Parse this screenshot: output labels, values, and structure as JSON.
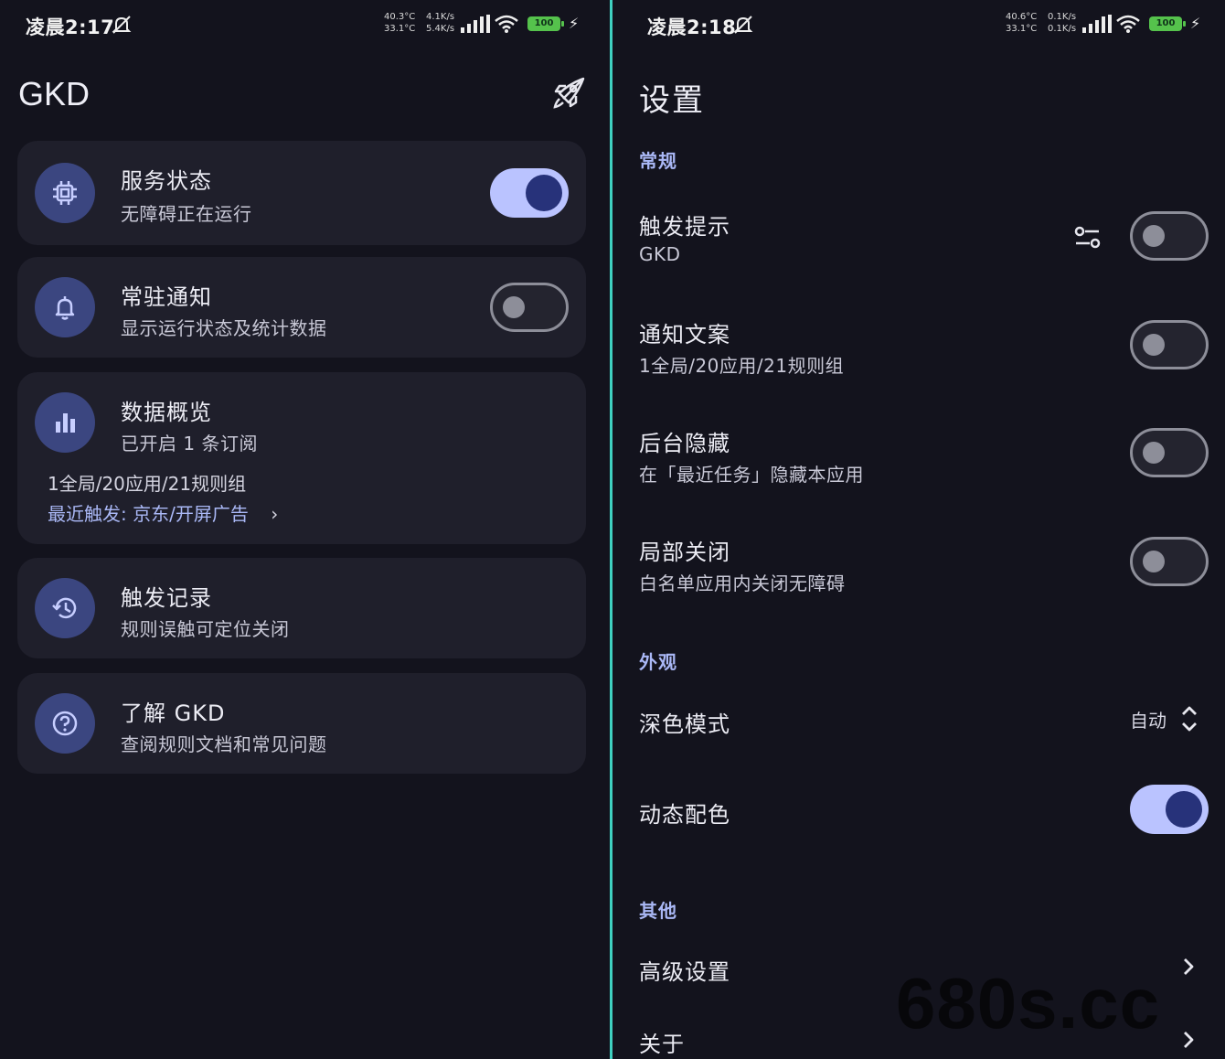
{
  "colors": {
    "background": "#13131d",
    "card": "#1f1f2b",
    "accent": "#bac3ff",
    "accent_dark": "#27327a",
    "icon_circle": "#3b4680",
    "section_label": "#aab8f6",
    "divider": "#3fd0c0",
    "battery": "#55c24c"
  },
  "left": {
    "status": {
      "time": "凌晨2:17",
      "temp_top": "40.3°C",
      "temp_bottom": "33.1°C",
      "speed_top": "4.1K/s",
      "speed_bottom": "5.4K/s",
      "battery": "100"
    },
    "app_title": "GKD",
    "header_icon": "rocket-icon",
    "cards": [
      {
        "title": "服务状态",
        "subtitle": "无障碍正在运行",
        "icon": "cpu-chip-icon",
        "switch_on": true
      },
      {
        "title": "常驻通知",
        "subtitle": "显示运行状态及统计数据",
        "icon": "bell-icon",
        "switch_on": false
      },
      {
        "title": "数据概览",
        "subtitle": "已开启 1 条订阅",
        "icon": "bar-chart-icon",
        "stats": "1全局/20应用/21规则组",
        "recent": "最近触发: 京东/开屏广告",
        "recent_chevron": "›"
      },
      {
        "title": "触发记录",
        "subtitle": "规则误触可定位关闭",
        "icon": "history-icon"
      },
      {
        "title": "了解 GKD",
        "subtitle": "查阅规则文档和常见问题",
        "icon": "help-circle-icon"
      }
    ]
  },
  "right": {
    "status": {
      "time": "凌晨2:18",
      "temp_top": "40.6°C",
      "temp_bottom": "33.1°C",
      "speed_top": "0.1K/s",
      "speed_bottom": "0.1K/s",
      "battery": "100"
    },
    "title": "设置",
    "sections": {
      "general": "常规",
      "appearance": "外观",
      "other": "其他"
    },
    "rows": {
      "trigger_tip": {
        "title": "触发提示",
        "subtitle": "GKD",
        "switch_on": false
      },
      "notify_text": {
        "title": "通知文案",
        "subtitle": "1全局/20应用/21规则组",
        "switch_on": false
      },
      "hide_bg": {
        "title": "后台隐藏",
        "subtitle": "在「最近任务」隐藏本应用",
        "switch_on": false
      },
      "partial_off": {
        "title": "局部关闭",
        "subtitle": "白名单应用内关闭无障碍",
        "switch_on": false
      },
      "dark_mode": {
        "title": "深色模式",
        "value": "自动"
      },
      "dynamic_color": {
        "title": "动态配色",
        "switch_on": true
      },
      "advanced": {
        "title": "高级设置"
      },
      "about": {
        "title": "关于"
      }
    },
    "watermark": "680s.cc"
  }
}
